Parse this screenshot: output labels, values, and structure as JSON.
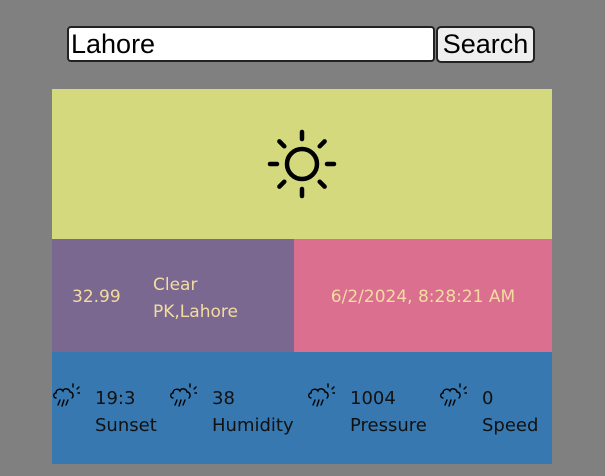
{
  "search": {
    "value": "Lahore",
    "button_label": "Search"
  },
  "weather": {
    "icon": "sun-icon",
    "temperature": "32.99",
    "condition": "Clear",
    "location": "PK,Lahore",
    "datetime": "6/2/2024, 8:28:21 AM"
  },
  "stats": [
    {
      "icon": "rain-cloud-icon",
      "value": "19:3",
      "label": "Sunset"
    },
    {
      "icon": "rain-cloud-icon",
      "value": "38",
      "label": "Humidity"
    },
    {
      "icon": "rain-cloud-icon",
      "value": "1004",
      "label": "Pressure"
    },
    {
      "icon": "rain-cloud-icon",
      "value": "0",
      "label": "Speed"
    }
  ],
  "colors": {
    "background": "#808080",
    "icon_panel": "#d5d97e",
    "temp_panel": "#7a6890",
    "date_panel": "#da6f90",
    "stats_panel": "#3778b0",
    "panel_text": "#f4dca0"
  }
}
